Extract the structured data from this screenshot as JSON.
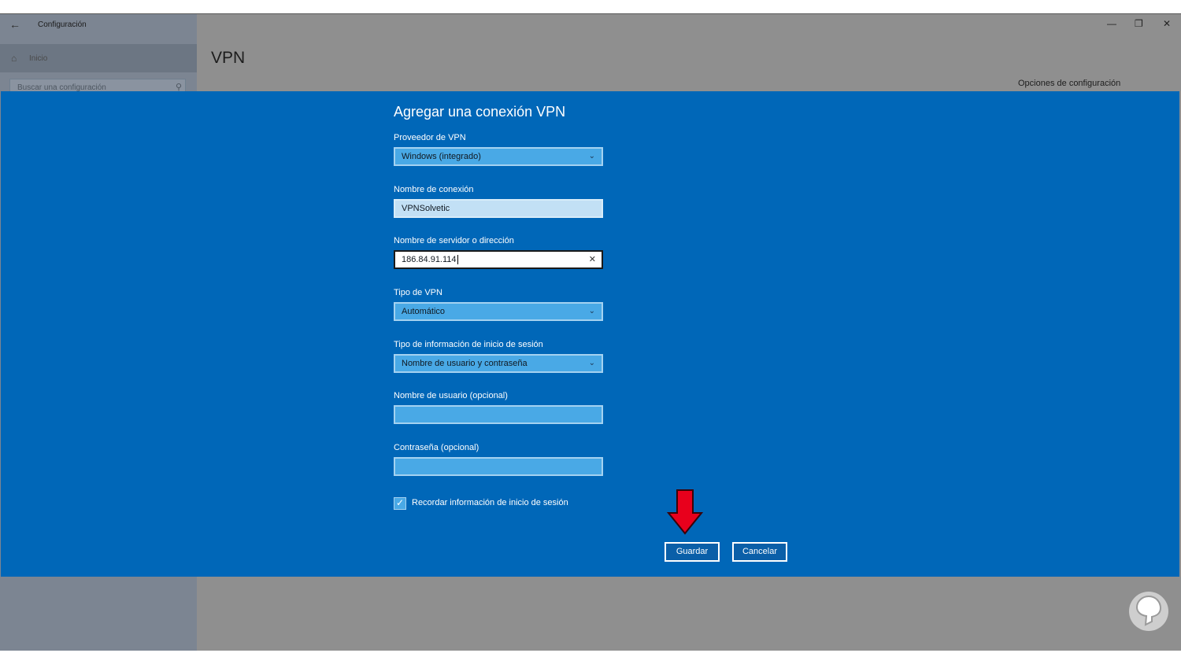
{
  "window": {
    "app_title": "Configuración",
    "back_glyph": "←",
    "minimize_glyph": "—",
    "restore_glyph": "❐",
    "close_glyph": "✕"
  },
  "sidebar": {
    "home_label": "Inicio",
    "home_glyph": "⌂",
    "search_placeholder": "Buscar una configuración",
    "search_glyph": "⚲"
  },
  "main": {
    "page_title": "VPN",
    "options_label": "Opciones de configuración"
  },
  "dialog": {
    "title": "Agregar una conexión VPN",
    "fields": {
      "provider": {
        "label": "Proveedor de VPN",
        "value": "Windows (integrado)"
      },
      "connection_name": {
        "label": "Nombre de conexión",
        "value": "VPNSolvetic"
      },
      "server": {
        "label": "Nombre de servidor o dirección",
        "value": "186.84.91.114"
      },
      "vpn_type": {
        "label": "Tipo de VPN",
        "value": "Automático"
      },
      "signin_type": {
        "label": "Tipo de información de inicio de sesión",
        "value": "Nombre de usuario y contraseña"
      },
      "username": {
        "label": "Nombre de usuario (opcional)",
        "value": ""
      },
      "password": {
        "label": "Contraseña (opcional)",
        "value": ""
      }
    },
    "remember": {
      "label": "Recordar información de inicio de sesión",
      "checked": true,
      "glyph": "✓"
    },
    "chevron_glyph": "⌄",
    "clear_glyph": "✕",
    "save_label": "Guardar",
    "cancel_label": "Cancelar",
    "colors": {
      "dialog_bg": "#0067b8",
      "field_bg": "#49a9e6",
      "arrow": "#e8001c"
    }
  }
}
